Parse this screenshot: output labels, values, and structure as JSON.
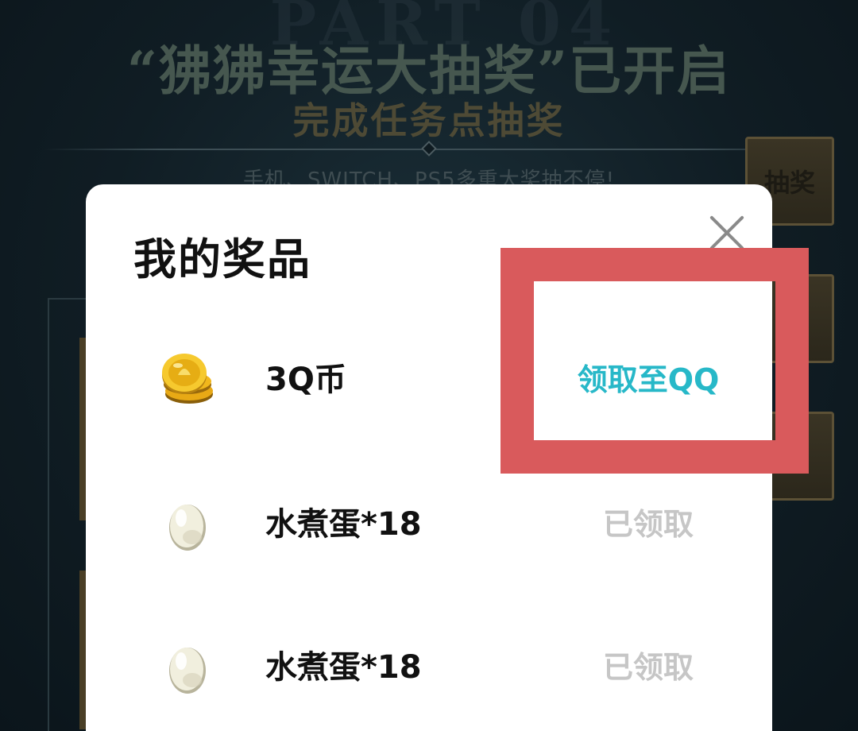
{
  "background": {
    "watermark": "PART 04",
    "title": "“狒狒幸运大抽奖”已开启",
    "subtitle": "完成任务点抽奖",
    "tagline": "手机、SWITCH、PS5多重大奖抽不停!",
    "side_button_label": "抽奖"
  },
  "modal": {
    "title": "我的奖品",
    "close_icon": "close-icon",
    "prizes": [
      {
        "name": "3Q币",
        "icon": "coin-stack-icon",
        "action": "领取至QQ",
        "claimable": true
      },
      {
        "name": "水煮蛋*18",
        "icon": "egg-icon",
        "action": "已领取",
        "claimable": false
      },
      {
        "name": "水煮蛋*18",
        "icon": "egg-icon",
        "action": "已领取",
        "claimable": false
      }
    ]
  },
  "colors": {
    "claim_accent": "#27b8c8",
    "claimed_gray": "#c6c6c6",
    "highlight_red": "#d95a5c"
  }
}
